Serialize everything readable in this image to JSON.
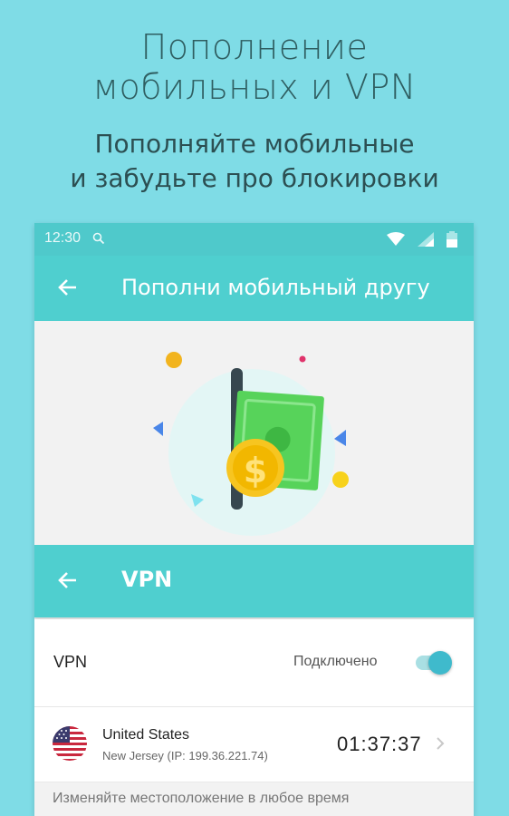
{
  "promo": {
    "title_line1": "Пополнение",
    "title_line2": "мобильных и VPN",
    "subtitle_line1": "Пополняйте мобильные",
    "subtitle_line2": "и забудьте про блокировки"
  },
  "statusbar": {
    "time": "12:30",
    "icons": [
      "search-icon",
      "wifi-icon",
      "signal-icon",
      "battery-icon"
    ]
  },
  "topup_screen": {
    "title": "Пополни мобильный другу",
    "back_icon": "arrow-left-icon"
  },
  "vpn_screen": {
    "title": "VPN",
    "back_icon": "arrow-left-icon",
    "toggle_row": {
      "label": "VPN",
      "status": "Подключено",
      "enabled": true
    },
    "location": {
      "country": "United States",
      "region": "New Jersey (IP: 199.36.221.74)",
      "timer": "01:37:37",
      "flag_icon": "us-flag-icon"
    },
    "hint": "Изменяйте местоположение в любое время"
  },
  "colors": {
    "background": "#7fdce6",
    "appbar": "#4fcfcf",
    "accent": "#3fbacc",
    "bill": "#57d35a",
    "coin": "#f7c520"
  }
}
